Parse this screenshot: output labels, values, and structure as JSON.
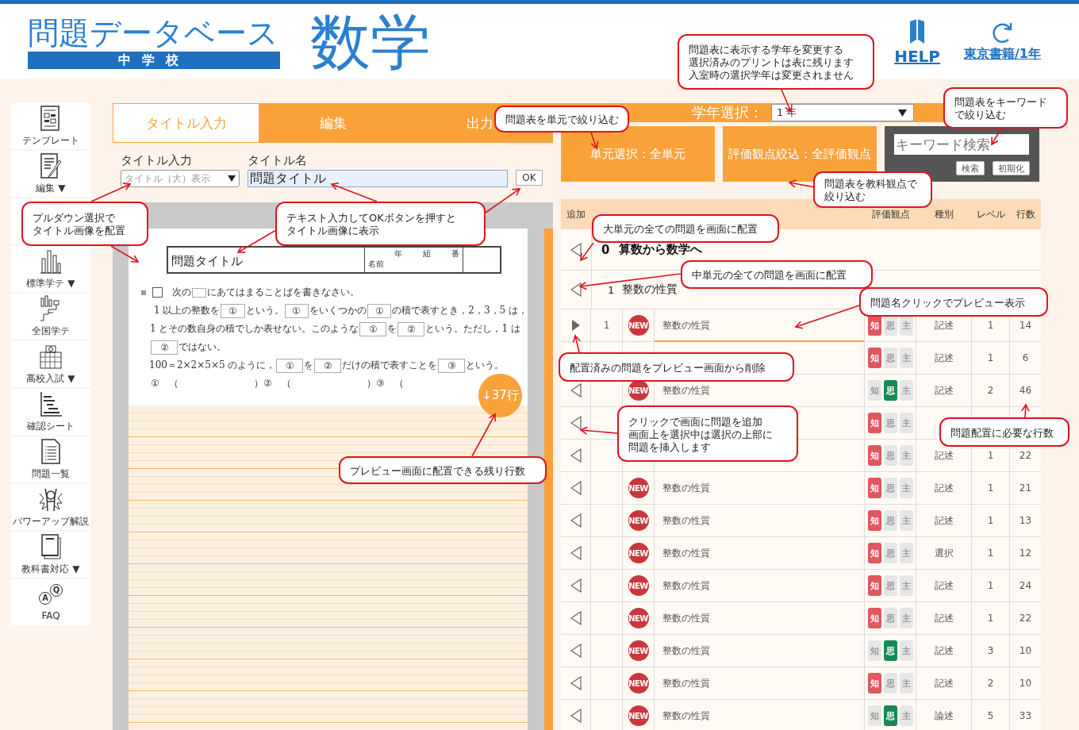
{
  "header": {
    "logo_title": "問題データベース",
    "logo_subtitle": "中学校",
    "subject": "数学",
    "help": "HELP",
    "publisher": "東京書籍/1年"
  },
  "sidebar": {
    "items": [
      {
        "kind": "item",
        "label": "テンプレート"
      },
      {
        "kind": "item",
        "label": "編集 ▼"
      },
      {
        "kind": "covered"
      },
      {
        "kind": "item",
        "label": "標準学テ ▼"
      },
      {
        "kind": "item",
        "label": "全国学テ"
      },
      {
        "kind": "item",
        "label": "高校入試 ▼"
      },
      {
        "kind": "item",
        "label": "確認シート"
      },
      {
        "kind": "item",
        "label": "問題一覧"
      },
      {
        "kind": "item",
        "label": "パワーアップ解説"
      },
      {
        "kind": "item",
        "label": "教科書対応 ▼"
      },
      {
        "kind": "faq",
        "label": "FAQ",
        "icon_letters": [
          "A",
          "Q"
        ]
      }
    ]
  },
  "tabs": [
    {
      "label": "タイトル入力",
      "selected": true
    },
    {
      "label": "編集",
      "selected": false
    },
    {
      "label": "出力",
      "selected": false
    }
  ],
  "grade": {
    "label": "学年選択：",
    "value": "1 年"
  },
  "title_form": {
    "style_label": "タイトル入力",
    "style_value": "タイトル（大）表示",
    "name_label": "タイトル名",
    "name_value": "問題タイトル",
    "ok": "OK"
  },
  "preview": {
    "title": "問題タイトル",
    "name_label": "名前",
    "class_labels": [
      "年",
      "組",
      "番"
    ],
    "remaining": "↓37行",
    "lines": [
      [
        {
          "kind": "mark"
        },
        {
          "kind": "square"
        },
        {
          "kind": "text",
          "text": "次の"
        },
        {
          "kind": "blank"
        },
        {
          "kind": "text",
          "text": "にあてはまることばを書きなさい。"
        }
      ],
      [
        {
          "kind": "text",
          "text": "1 以上の整数を"
        },
        {
          "kind": "blank",
          "text": "①"
        },
        {
          "kind": "text",
          "text": "という。"
        },
        {
          "kind": "blank",
          "text": "①"
        },
        {
          "kind": "text",
          "text": "をいくつかの"
        },
        {
          "kind": "blank",
          "text": "①"
        },
        {
          "kind": "text",
          "text": "の積で表すとき，2，3，5 は，"
        }
      ],
      [
        {
          "kind": "text",
          "text": "1 とその数自身の積でしか表せない。このような"
        },
        {
          "kind": "blank",
          "text": "①"
        },
        {
          "kind": "text",
          "text": "を"
        },
        {
          "kind": "blank",
          "text": "②"
        },
        {
          "kind": "text",
          "text": "という。ただし，1 は"
        }
      ],
      [
        {
          "kind": "blank",
          "text": "②"
        },
        {
          "kind": "text",
          "text": "ではない。"
        }
      ],
      [
        {
          "kind": "text",
          "text": "100＝2×2×5×5 のように，"
        },
        {
          "kind": "blank",
          "text": "①"
        },
        {
          "kind": "text",
          "text": "を"
        },
        {
          "kind": "blank",
          "text": "②"
        },
        {
          "kind": "text",
          "text": "だけの積で表すことを"
        },
        {
          "kind": "blank",
          "text": "③"
        },
        {
          "kind": "text",
          "text": "という。"
        }
      ],
      [
        {
          "kind": "text",
          "text": "①　（"
        },
        {
          "kind": "gap"
        },
        {
          "kind": "text",
          "text": "）"
        },
        {
          "kind": "text",
          "text": "②　（"
        },
        {
          "kind": "gap"
        },
        {
          "kind": "text",
          "text": "）"
        },
        {
          "kind": "text",
          "text": "③　（"
        }
      ]
    ]
  },
  "filters": {
    "unit": "単元選択：全単元",
    "eval": "評価観点絞込：全評価観点",
    "keyword_placeholder": "キーワード検索",
    "search": "検索",
    "reset": "初期化"
  },
  "table": {
    "columns": {
      "add": "追加",
      "eval": "評価観点",
      "type": "種別",
      "level": "レベル",
      "lines": "行数"
    },
    "unit": {
      "number": "0",
      "title": "算数から数学へ"
    },
    "subunit": {
      "number": "1",
      "title": "整数の性質"
    },
    "rows": [
      {
        "kind": "placed",
        "number": "1",
        "badge": "NEW",
        "name": "整数の性質",
        "selected": true,
        "eval": [
          {
            "label": "知",
            "on": true
          },
          {
            "label": "思",
            "on": false
          },
          {
            "label": "主",
            "on": false
          }
        ],
        "type": "記述",
        "level": "1",
        "lines": "14"
      },
      {
        "kind": "covered",
        "selected": false,
        "eval": [
          {
            "label": "知",
            "on": true
          },
          {
            "label": "思",
            "on": false
          },
          {
            "label": "主",
            "on": false
          }
        ],
        "type": "記述",
        "level": "1",
        "lines": "6"
      },
      {
        "kind": "add",
        "badge": "NEW",
        "name": "整数の性質",
        "selected": false,
        "eval": [
          {
            "label": "知",
            "on": false
          },
          {
            "label": "思",
            "on": true
          },
          {
            "label": "主",
            "on": false
          }
        ],
        "type": "記述",
        "level": "2",
        "lines": "46"
      },
      {
        "kind": "add",
        "selected": false,
        "eval": [
          {
            "label": "知",
            "on": true
          },
          {
            "label": "思",
            "on": false
          },
          {
            "label": "主",
            "on": false
          }
        ]
      },
      {
        "kind": "add",
        "selected": false,
        "eval": [
          {
            "label": "知",
            "on": true
          },
          {
            "label": "思",
            "on": false
          },
          {
            "label": "主",
            "on": false
          }
        ],
        "type": "記述",
        "level": "1",
        "lines": "22"
      },
      {
        "kind": "add",
        "badge": "NEW",
        "name": "整数の性質",
        "selected": false,
        "eval": [
          {
            "label": "知",
            "on": true
          },
          {
            "label": "思",
            "on": false
          },
          {
            "label": "主",
            "on": false
          }
        ],
        "type": "記述",
        "level": "1",
        "lines": "21"
      },
      {
        "kind": "add",
        "badge": "NEW",
        "name": "整数の性質",
        "selected": false,
        "eval": [
          {
            "label": "知",
            "on": true
          },
          {
            "label": "思",
            "on": false
          },
          {
            "label": "主",
            "on": false
          }
        ],
        "type": "記述",
        "level": "1",
        "lines": "13"
      },
      {
        "kind": "add",
        "badge": "NEW",
        "name": "整数の性質",
        "selected": false,
        "eval": [
          {
            "label": "知",
            "on": true
          },
          {
            "label": "思",
            "on": false
          },
          {
            "label": "主",
            "on": false
          }
        ],
        "type": "選択",
        "level": "1",
        "lines": "12"
      },
      {
        "kind": "add",
        "badge": "NEW",
        "name": "整数の性質",
        "selected": false,
        "eval": [
          {
            "label": "知",
            "on": true
          },
          {
            "label": "思",
            "on": false
          },
          {
            "label": "主",
            "on": false
          }
        ],
        "type": "記述",
        "level": "1",
        "lines": "24"
      },
      {
        "kind": "add",
        "badge": "NEW",
        "name": "整数の性質",
        "selected": false,
        "eval": [
          {
            "label": "知",
            "on": true
          },
          {
            "label": "思",
            "on": false
          },
          {
            "label": "主",
            "on": false
          }
        ],
        "type": "記述",
        "level": "1",
        "lines": "22"
      },
      {
        "kind": "add",
        "badge": "NEW",
        "name": "整数の性質",
        "selected": false,
        "eval": [
          {
            "label": "知",
            "on": false
          },
          {
            "label": "思",
            "on": true
          },
          {
            "label": "主",
            "on": false
          }
        ],
        "type": "記述",
        "level": "3",
        "lines": "10"
      },
      {
        "kind": "add",
        "badge": "NEW",
        "name": "整数の性質",
        "selected": false,
        "eval": [
          {
            "label": "知",
            "on": true
          },
          {
            "label": "思",
            "on": false
          },
          {
            "label": "主",
            "on": false
          }
        ],
        "type": "記述",
        "level": "2",
        "lines": "10"
      },
      {
        "kind": "add",
        "badge": "NEW",
        "name": "整数の性質",
        "selected": false,
        "eval": [
          {
            "label": "知",
            "on": false
          },
          {
            "label": "思",
            "on": true
          },
          {
            "label": "主",
            "on": false
          }
        ],
        "type": "論述",
        "level": "5",
        "lines": "33"
      }
    ]
  },
  "callouts": [
    {
      "lines": [
        "問題表に表示する学年を変更する",
        "選択済みのプリントは表に残ります",
        "入室時の選択学年は変更されません"
      ]
    },
    {
      "lines": [
        "問題表をキーワード",
        "で絞り込む"
      ]
    },
    {
      "lines": [
        "問題表を単元で絞り込む"
      ]
    },
    {
      "lines": [
        "問題表を教科観点で",
        "絞り込む"
      ]
    },
    {
      "lines": [
        "プルダウン選択で",
        "タイトル画像を配置"
      ]
    },
    {
      "lines": [
        "テキスト入力してOKボタンを押すと",
        "タイトル画像に表示"
      ]
    },
    {
      "lines": [
        "大単元の全ての問題を画面に配置"
      ]
    },
    {
      "lines": [
        "中単元の全ての問題を画面に配置"
      ]
    },
    {
      "lines": [
        "問題名クリックでプレビュー表示"
      ]
    },
    {
      "lines": [
        "配置済みの問題をプレビュー画面から削除"
      ]
    },
    {
      "lines": [
        "クリックで画面に問題を追加",
        "画面上を選択中は選択の上部に",
        "問題を挿入します"
      ]
    },
    {
      "lines": [
        "問題配置に必要な行数"
      ]
    },
    {
      "lines": [
        "プレビュー画面に配置できる残り行数"
      ]
    }
  ]
}
